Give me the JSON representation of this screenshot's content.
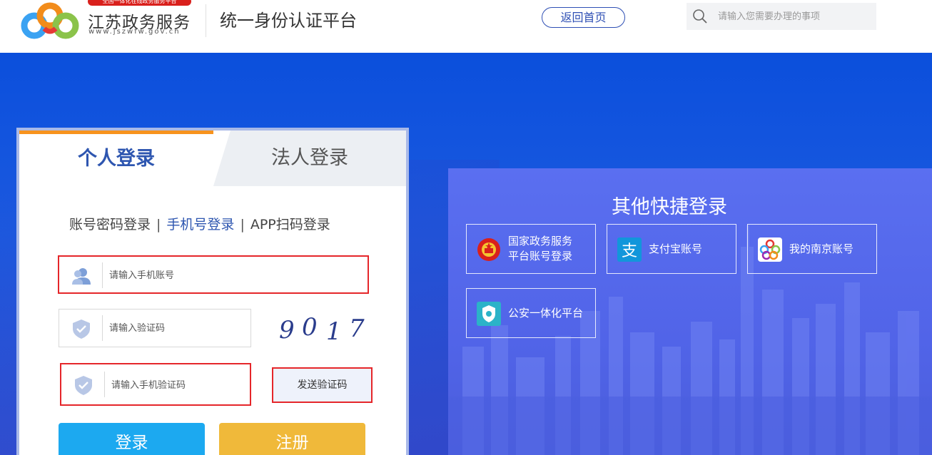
{
  "header": {
    "tagline": "全国一体化在线政务服务平台",
    "site_name": "江苏政务服务",
    "site_url": "www.jszwfw.gov.cn",
    "platform_title": "统一身份认证平台",
    "home_button": "返回首页",
    "search_placeholder": "请输入您需要办理的事项"
  },
  "login": {
    "tabs": [
      "个人登录",
      "法人登录"
    ],
    "methods": [
      "账号密码登录",
      "手机号登录",
      "APP扫码登录"
    ],
    "separator": "|",
    "phone_placeholder": "请输入手机账号",
    "captcha_placeholder": "请输入验证码",
    "captcha_chars": [
      "9",
      "0",
      "1",
      "7"
    ],
    "sms_placeholder": "请输入手机验证码",
    "send_code": "发送验证码",
    "login_button": "登录",
    "register_button": "注册"
  },
  "other": {
    "title": "其他快捷登录",
    "items": [
      {
        "line1": "国家政务服务",
        "line2": "平台账号登录"
      },
      {
        "line1": "支付宝账号",
        "line2": ""
      },
      {
        "line1": "我的南京账号",
        "line2": ""
      },
      {
        "line1": "公安一体化平台",
        "line2": ""
      }
    ]
  },
  "colors": {
    "primary_blue": "#2e56b0",
    "tab_accent": "#f7931e",
    "highlight_red": "#e5262a",
    "login_button": "#1ca9f0",
    "register_button": "#f0b93a",
    "banner_blue": "#0b4fdc"
  }
}
